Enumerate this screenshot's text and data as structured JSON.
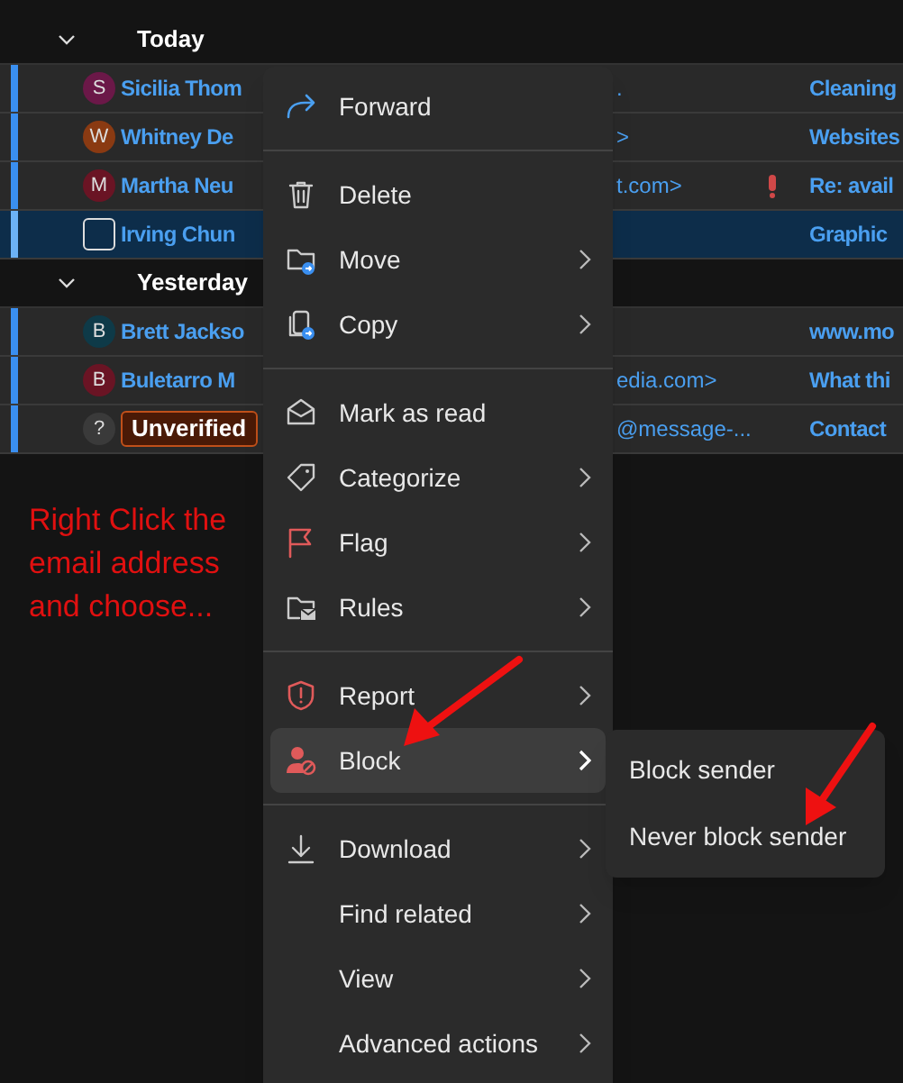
{
  "message_list": {
    "groups": [
      {
        "label": "Today",
        "expanded": true,
        "rows": [
          {
            "avatar": "S",
            "color": "#6b1848",
            "sender": "Sicilia Thom",
            "sender_tail": ".",
            "important": false,
            "subject": "Cleaning",
            "unread": true,
            "selected": false
          },
          {
            "avatar": "W",
            "color": "#8a3a12",
            "sender": "Whitney De",
            "sender_tail": ">",
            "important": false,
            "subject": "Websites",
            "unread": true,
            "selected": false
          },
          {
            "avatar": "M",
            "color": "#6a1424",
            "sender": "Martha Neu",
            "sender_tail": "t.com>",
            "important": true,
            "subject": "Re: avail",
            "unread": true,
            "selected": false
          },
          {
            "sender": "Irving Chun",
            "important": false,
            "subject": "Graphic",
            "unread": true,
            "selected": true
          }
        ]
      },
      {
        "label": "Yesterday",
        "expanded": true,
        "rows": [
          {
            "avatar": "B",
            "color": "#0e3a48",
            "sender": "Brett Jackso",
            "important": false,
            "subject": "www.mo",
            "unread": true,
            "selected": false
          },
          {
            "avatar": "B",
            "color": "#6a1424",
            "sender": "Buletarro M",
            "sender_tail": "edia.com>",
            "important": false,
            "subject": "What thi",
            "unread": true,
            "selected": false
          },
          {
            "avatar": "?",
            "color": "#3a3a3a",
            "badge": "Unverified",
            "sender_tail": "@message-...",
            "important": false,
            "subject": "Contact",
            "unread": true,
            "selected": false
          }
        ]
      }
    ]
  },
  "annotation": {
    "text": "Right Click the email address and choose..."
  },
  "context_menu": {
    "items": [
      {
        "kind": "item",
        "label": "Forward",
        "submenu": false,
        "selected": false
      },
      {
        "kind": "separator"
      },
      {
        "kind": "item",
        "label": "Delete",
        "submenu": false,
        "selected": false
      },
      {
        "kind": "item",
        "label": "Move",
        "submenu": true,
        "selected": false
      },
      {
        "kind": "item",
        "label": "Copy",
        "submenu": true,
        "selected": false
      },
      {
        "kind": "separator"
      },
      {
        "kind": "item",
        "label": "Mark as read",
        "submenu": false,
        "selected": false
      },
      {
        "kind": "item",
        "label": "Categorize",
        "submenu": true,
        "selected": false
      },
      {
        "kind": "item",
        "label": "Flag",
        "submenu": true,
        "selected": false
      },
      {
        "kind": "item",
        "label": "Rules",
        "submenu": true,
        "selected": false
      },
      {
        "kind": "separator"
      },
      {
        "kind": "item",
        "label": "Report",
        "submenu": true,
        "selected": false
      },
      {
        "kind": "item",
        "label": "Block",
        "submenu": true,
        "selected": true
      },
      {
        "kind": "separator"
      },
      {
        "kind": "item",
        "label": "Download",
        "submenu": true,
        "selected": false
      },
      {
        "kind": "item",
        "label": "Find related",
        "submenu": true,
        "selected": false
      },
      {
        "kind": "item",
        "label": "View",
        "submenu": true,
        "selected": false
      },
      {
        "kind": "item",
        "label": "Advanced actions",
        "submenu": true,
        "selected": false
      }
    ]
  },
  "submenu": {
    "items": [
      "Block sender",
      "Never block sender"
    ]
  }
}
